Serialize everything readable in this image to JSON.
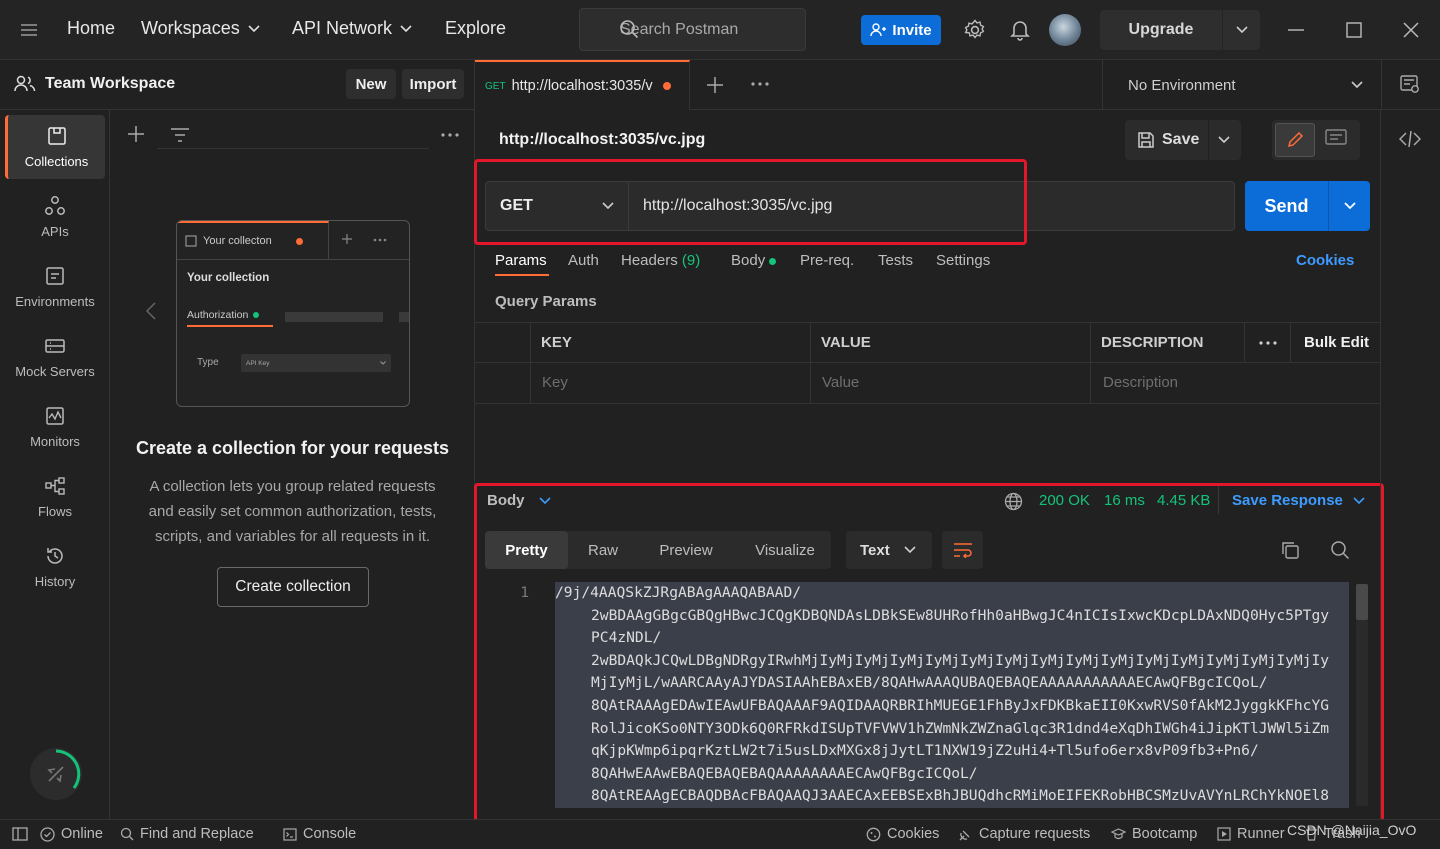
{
  "topbar": {
    "menu_icon": "hamburger-icon",
    "nav": [
      "Home",
      "Workspaces",
      "API Network",
      "Explore"
    ],
    "search_placeholder": "Search Postman",
    "invite_label": "Invite",
    "upgrade_label": "Upgrade"
  },
  "workspace": {
    "title": "Team Workspace",
    "new_label": "New",
    "import_label": "Import"
  },
  "rail": [
    {
      "label": "Collections",
      "icon": "collections-icon"
    },
    {
      "label": "APIs",
      "icon": "apis-icon"
    },
    {
      "label": "Environments",
      "icon": "environments-icon"
    },
    {
      "label": "Mock Servers",
      "icon": "mock-servers-icon"
    },
    {
      "label": "Monitors",
      "icon": "monitors-icon"
    },
    {
      "label": "Flows",
      "icon": "flows-icon"
    },
    {
      "label": "History",
      "icon": "history-icon"
    }
  ],
  "illustration": {
    "tab_label": "Your collecton",
    "collection_name": "Your collection",
    "auth_label": "Authorization",
    "type_label": "Type",
    "type_value": "API Key"
  },
  "empty_state": {
    "title": "Create a collection for your requests",
    "lines": [
      "A collection lets you group related requests",
      "and easily set common authorization, tests,",
      "scripts, and variables for all requests in it."
    ],
    "button": "Create collection"
  },
  "request_tab": {
    "method": "GET",
    "label": "http://localhost:3035/v"
  },
  "environment": "No Environment",
  "request": {
    "title": "http://localhost:3035/vc.jpg",
    "save_label": "Save",
    "method": "GET",
    "url": "http://localhost:3035/vc.jpg",
    "send_label": "Send",
    "tabs": [
      "Params",
      "Auth",
      "Headers",
      "Body",
      "Pre-req.",
      "Tests",
      "Settings"
    ],
    "headers_count": "(9)",
    "cookies_label": "Cookies",
    "query_params_label": "Query Params",
    "table_headers": [
      "KEY",
      "VALUE",
      "DESCRIPTION"
    ],
    "bulk_edit": "Bulk Edit",
    "placeholders": [
      "Key",
      "Value",
      "Description"
    ]
  },
  "response": {
    "body_label": "Body",
    "status": "200 OK",
    "time": "16 ms",
    "size": "4.45 KB",
    "save_response": "Save Response",
    "view_tabs": [
      "Pretty",
      "Raw",
      "Preview",
      "Visualize"
    ],
    "format": "Text",
    "line_number": "1",
    "lines": [
      "/9j/4AAQSkZJRgABAgAAAQABAAD/",
      "2wBDAAgGBgcGBQgHBwcJCQgKDBQNDAsLDBkSEw8UHRofHh0aHBwgJC4nICIsIxwcKDcpLDAxNDQ0Hyc5PTgy",
      "PC4zNDL/",
      "2wBDAQkJCQwLDBgNDRgyIRwhMjIyMjIyMjIyMjIyMjIyMjIyMjIyMjIyMjIyMjIyMjIyMjIyMjIyMjIyMjIy",
      "MjIyMjL/wAARCAAyAJYDASIAAhEBAxEB/8QAHwAAAQUBAQEBAQEAAAAAAAAAAAECAwQFBgcICQoL/",
      "8QAtRAAAgEDAwIEAwUFBAQAAAF9AQIDAAQRBRIhMUEGE1FhByJxFDKBkaEII0KxwRVS0fAkM2JyggkKFhcYG",
      "RolJicoKSo0NTY3ODk6Q0RFRkdISUpTVFVWV1hZWmNkZWZnaGlqc3R1dnd4eXqDhIWGh4iJipKTlJWWl5iZm",
      "qKjpKWmp6ipqrKztLW2t7i5usLDxMXGx8jJytLT1NXW19jZ2uHi4+Tl5ufo6erx8vP09fb3+Pn6/",
      "8QAHwEAAwEBAQEBAQEBAQAAAAAAAAECAwQFBgcICQoL/",
      "8QAtREAAgECBAQDBAcFBAQAAQJ3AAECAxEEBSExBhJBUQdhcRMiMoEIFEKRobHBCSMzUvAVYnLRChYkNOEl8"
    ]
  },
  "statusbar": {
    "left": [
      "Online",
      "Find and Replace",
      "Console"
    ],
    "right": [
      "Cookies",
      "Capture requests",
      "Bootcamp",
      "Runner",
      "Trash"
    ],
    "watermark": "CSDN @Naijia_OvO"
  }
}
